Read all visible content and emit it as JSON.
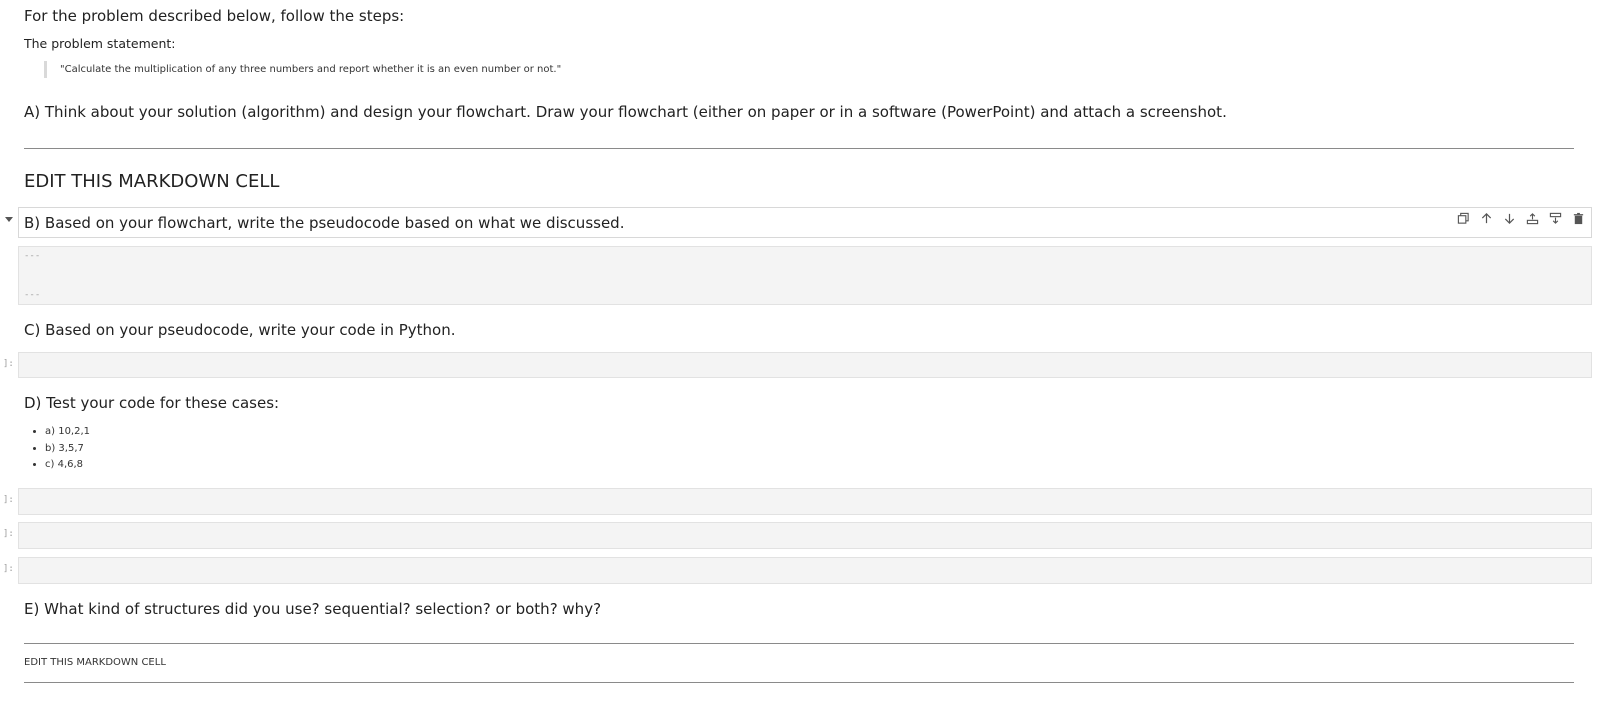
{
  "intro": {
    "title": "For the problem described below, follow the steps:",
    "problem_label": "The problem statement:",
    "problem_quote": "\"Calculate the multiplication of any three numbers and report whether it is an even number or not.\""
  },
  "section_a": {
    "text": "A) Think about your solution (algorithm) and design your flowchart. Draw your flowchart (either on paper or in a software (PowerPoint) and attach a screenshot.",
    "edit_heading": "EDIT THIS MARKDOWN CELL"
  },
  "section_b": {
    "text": "B) Based on your flowchart, write the pseudocode based on what we discussed.",
    "raw_top": "---",
    "raw_bottom": "---"
  },
  "section_c": {
    "text": "C) Based on your pseudocode, write your code in Python.",
    "prompt": "]:"
  },
  "section_d": {
    "text": "D) Test your code for these cases:",
    "cases": [
      "a) 10,2,1",
      "b) 3,5,7",
      "c) 4,6,8"
    ],
    "prompts": [
      "]:",
      "]:",
      "]:"
    ]
  },
  "section_e": {
    "text": "E) What kind of structures did you use? sequential? selection? or both? why?",
    "edit_text": "EDIT THIS MARKDOWN CELL"
  },
  "toolbar": {
    "icons": [
      "duplicate-icon",
      "move-up-icon",
      "move-down-icon",
      "insert-above-icon",
      "insert-below-icon",
      "delete-icon"
    ]
  },
  "colors": {
    "cell_background": "#f4f4f4",
    "cell_border": "#e2e2e2",
    "rule": "#8a8a8a",
    "quote_border": "#d9d9d9"
  }
}
